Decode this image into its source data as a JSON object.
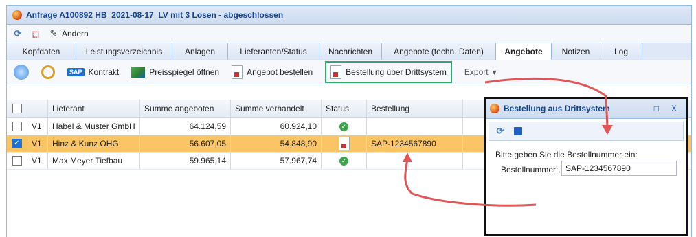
{
  "window": {
    "title": "Anfrage A100892 HB_2021-08-17_LV mit 3 Losen - abgeschlossen"
  },
  "toolbar": {
    "edit_label": "Ändern"
  },
  "tabs": [
    {
      "label": "Kopfdaten"
    },
    {
      "label": "Leistungsverzeichnis"
    },
    {
      "label": "Anlagen"
    },
    {
      "label": "Lieferanten/Status"
    },
    {
      "label": "Nachrichten"
    },
    {
      "label": "Angebote (techn. Daten)"
    },
    {
      "label": "Angebote"
    },
    {
      "label": "Notizen"
    },
    {
      "label": "Log"
    }
  ],
  "actions": {
    "kontrakt": "Kontrakt",
    "preisspiegel": "Preisspiegel öffnen",
    "angebot_bestellen": "Angebot bestellen",
    "bestellung_dritt": "Bestellung über Drittsystem",
    "export": "Export"
  },
  "grid": {
    "headers": {
      "lieferant": "Lieferant",
      "summe_angeboten": "Summe angeboten",
      "summe_verhandelt": "Summe verhandelt",
      "status": "Status",
      "bestellung": "Bestellung"
    },
    "rows": [
      {
        "los": "V1",
        "lieferant": "Habel & Muster GmbH",
        "angeboten": "64.124,59",
        "verhandelt": "60.924,10",
        "status": "ok",
        "bestellung": "",
        "checked": false
      },
      {
        "los": "V1",
        "lieferant": "Hinz & Kunz OHG",
        "angeboten": "56.607,05",
        "verhandelt": "54.848,90",
        "status": "ordered",
        "bestellung": "SAP-1234567890",
        "checked": true
      },
      {
        "los": "V1",
        "lieferant": "Max Meyer Tiefbau",
        "angeboten": "59.965,14",
        "verhandelt": "57.967,74",
        "status": "ok",
        "bestellung": "",
        "checked": false
      }
    ]
  },
  "dialog": {
    "title": "Bestellung aus Drittsystem",
    "prompt": "Bitte geben Sie die Bestellnummer ein:",
    "field_label": "Bestellnummer:",
    "field_value": "SAP-1234567890"
  },
  "colors": {
    "selected_row": "#fbc464",
    "highlight_box": "#2eaa6d",
    "arrow": "#e05555"
  }
}
